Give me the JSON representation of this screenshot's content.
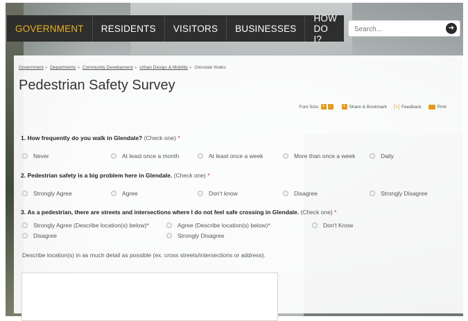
{
  "nav": {
    "items": [
      {
        "label": "GOVERNMENT",
        "active": true
      },
      {
        "label": "RESIDENTS",
        "active": false
      },
      {
        "label": "VISITORS",
        "active": false
      },
      {
        "label": "BUSINESSES",
        "active": false
      },
      {
        "label": "HOW DO I?",
        "active": false
      }
    ]
  },
  "search": {
    "placeholder": "Search...",
    "icon": "arrow-right-icon"
  },
  "breadcrumb": [
    "Government",
    "Departments",
    "Community Development",
    "Urban Design & Mobility",
    "Glendale Walks"
  ],
  "page_title": "Pedestrian Safety Survey",
  "tools": {
    "font_size_label": "Font Size:",
    "increase": "+",
    "decrease": "-",
    "share": "Share & Bookmark",
    "feedback": "Feedback",
    "print": "Print"
  },
  "questions": [
    {
      "number": "1.",
      "text": "How frequently do you walk in Glendale?",
      "hint": "(Check one)",
      "required": "*",
      "options": [
        "Never",
        "At least once a month",
        "At least once a week",
        "More than once a week",
        "Daily"
      ]
    },
    {
      "number": "2.",
      "text": "Pedestrian safety is a big problem here in Glendale.",
      "hint": "(Check one)",
      "required": "*",
      "options": [
        "Strongly Agree",
        "Agree",
        "Don't know",
        "Disagree",
        "Strongly Disagree"
      ]
    },
    {
      "number": "3.",
      "text": "As a pedestrian, there are streets and intersections where I do not feel safe crossing in Glendale.",
      "hint": "(Check one)",
      "required": "*",
      "options": [
        "Strongly Agree (Describe location(s) below)*",
        "Agree (Describe location(s) below)*",
        "Don't Know",
        "Disagree",
        "Strongly Disagree"
      ]
    }
  ],
  "describe_label": "Describe location(s) in as much detail as possible (ex. cross streets/intersections or address).",
  "colors": {
    "accent": "#e8b31e",
    "nav_bg": "#2e2e2e",
    "tool_orange": "#e39a1a",
    "required": "#c0392b"
  }
}
